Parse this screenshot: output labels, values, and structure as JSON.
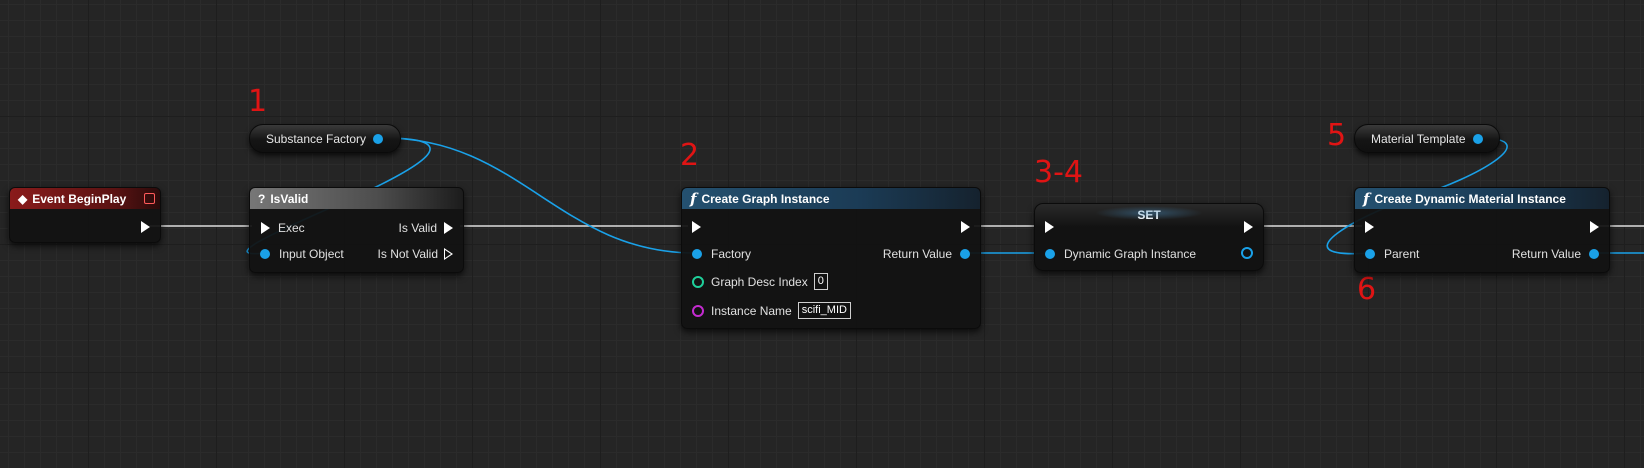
{
  "annotations": [
    "1",
    "2",
    "3-4",
    "5",
    "6"
  ],
  "nodes": {
    "event_begin_play": {
      "title": "Event BeginPlay"
    },
    "substance_factory": {
      "label": "Substance Factory"
    },
    "is_valid": {
      "title": "IsValid",
      "exec": "Exec",
      "input_object": "Input Object",
      "is_valid": "Is Valid",
      "is_not_valid": "Is Not Valid"
    },
    "create_graph_instance": {
      "title": "Create Graph Instance",
      "factory": "Factory",
      "return_value": "Return Value",
      "graph_desc_index": "Graph Desc Index",
      "graph_desc_index_value": "0",
      "instance_name": "Instance Name",
      "instance_name_value": "scifi_MID"
    },
    "set": {
      "title": "SET",
      "dynamic_graph_instance": "Dynamic Graph Instance"
    },
    "material_template": {
      "label": "Material Template"
    },
    "create_dynamic_material_instance": {
      "title": "Create Dynamic Material Instance",
      "parent": "Parent",
      "return_value": "Return Value"
    }
  },
  "colors": {
    "exec": "#ffffff",
    "object_pin": "#1aa1e8",
    "int_pin": "#1fcf9a",
    "name_pin": "#c42bd0",
    "wire": "#1aa1e8",
    "annotation": "#e01414"
  }
}
